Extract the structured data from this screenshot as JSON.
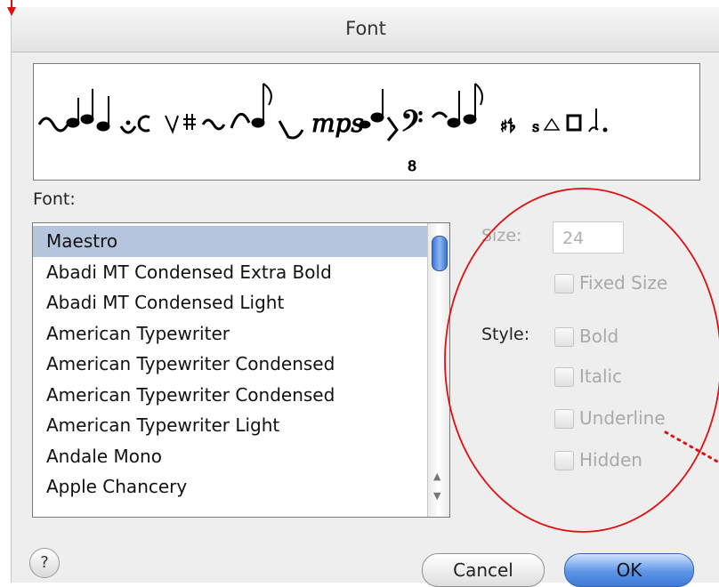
{
  "window": {
    "title": "Font"
  },
  "preview": {
    "sample_text": "𝅗𝅥𝅘𝅥𝄐𝄴𝄞 𝄢 8 ♯ ♭ ♮ 𝄽 𝄾 mp s"
  },
  "font_panel": {
    "label": "Font:",
    "items": [
      {
        "label": "Maestro",
        "selected": true
      },
      {
        "label": "Abadi MT Condensed Extra Bold"
      },
      {
        "label": "Abadi MT Condensed Light"
      },
      {
        "label": "American Typewriter"
      },
      {
        "label": "American Typewriter Condensed"
      },
      {
        "label": "American Typewriter Condensed"
      },
      {
        "label": "American Typewriter Light"
      },
      {
        "label": "Andale Mono"
      },
      {
        "label": "Apple Chancery"
      }
    ]
  },
  "size": {
    "label": "Size:",
    "value": "24"
  },
  "fixed_size": {
    "label": "Fixed Size"
  },
  "style": {
    "label": "Style:",
    "bold": "Bold",
    "italic": "Italic",
    "underline": "Underline",
    "hidden": "Hidden"
  },
  "buttons": {
    "cancel": "Cancel",
    "ok": "OK",
    "help": "?"
  },
  "colors": {
    "annotation_red": "#e01010",
    "selection": "#b6c5de",
    "ok_button": "#5d95e6"
  }
}
